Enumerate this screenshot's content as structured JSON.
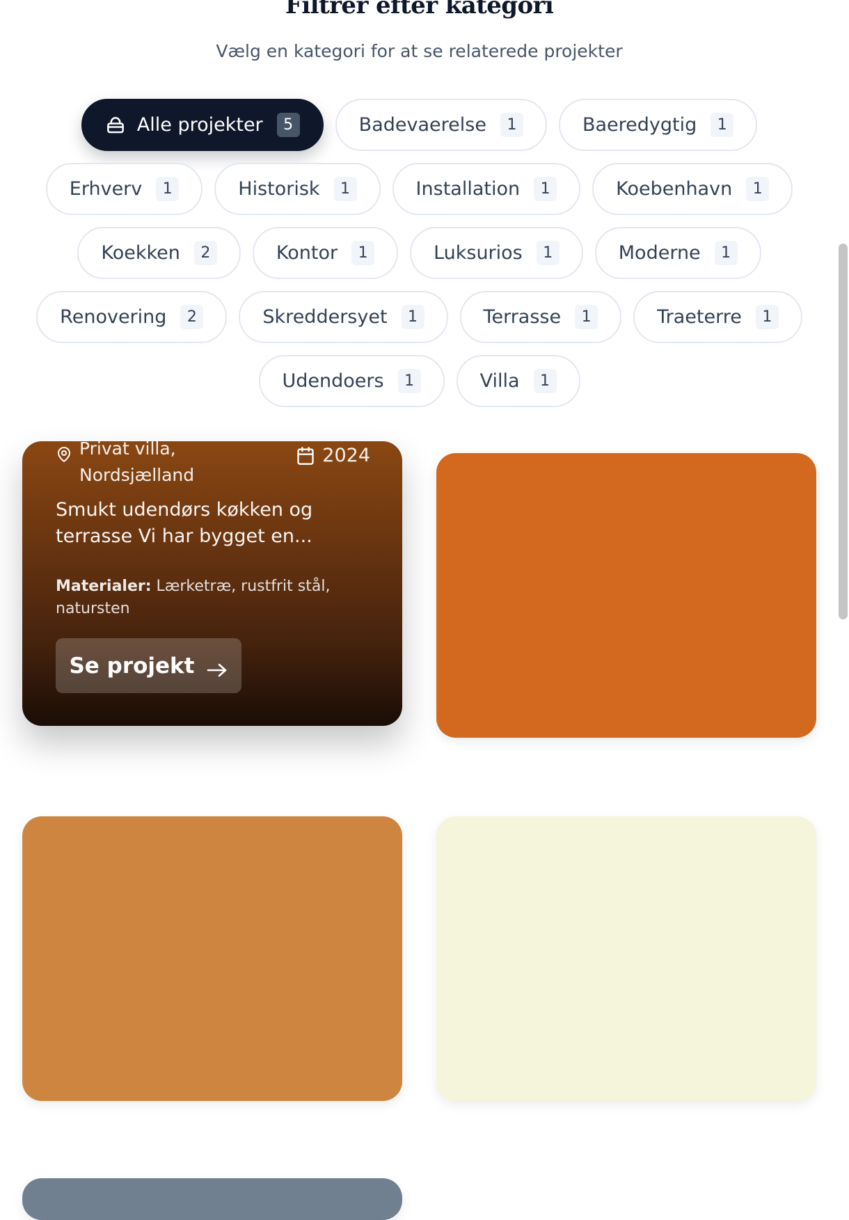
{
  "filter": {
    "title": "Filtrer efter kategori",
    "subtitle": "Vælg en kategori for at se relaterede projekter",
    "categories": [
      {
        "label": "Alle projekter",
        "count": "5",
        "active": true,
        "icon": "bag-icon"
      },
      {
        "label": "Badevaerelse",
        "count": "1"
      },
      {
        "label": "Baeredygtig",
        "count": "1"
      },
      {
        "label": "Erhverv",
        "count": "1"
      },
      {
        "label": "Historisk",
        "count": "1"
      },
      {
        "label": "Installation",
        "count": "1"
      },
      {
        "label": "Koebenhavn",
        "count": "1"
      },
      {
        "label": "Koekken",
        "count": "2"
      },
      {
        "label": "Kontor",
        "count": "1"
      },
      {
        "label": "Luksurios",
        "count": "1"
      },
      {
        "label": "Moderne",
        "count": "1"
      },
      {
        "label": "Renovering",
        "count": "2"
      },
      {
        "label": "Skreddersyet",
        "count": "1"
      },
      {
        "label": "Terrasse",
        "count": "1"
      },
      {
        "label": "Traeterre",
        "count": "1"
      },
      {
        "label": "Udendoers",
        "count": "1"
      },
      {
        "label": "Villa",
        "count": "1"
      }
    ]
  },
  "projects": [
    {
      "location": "Privat villa, Nordsjælland",
      "year": "2024",
      "description": "Smukt udendørs køkken og terrasse Vi har bygget en...",
      "materials_label": "Materialer:",
      "materials": "Lærketræ, rustfrit stål, natursten",
      "button_label": "Se projekt",
      "color": "#8b4513"
    },
    {
      "color": "#d2691e"
    },
    {
      "color": "#cd853f"
    },
    {
      "color": "#f5f5dc"
    },
    {
      "color": "#708090"
    }
  ],
  "icons": {
    "location": "map-pin-icon",
    "year": "calendar-icon",
    "button": "arrow-right-icon"
  },
  "colors": {
    "active_chip": "#0f172a",
    "chip_border": "#e2e8f0",
    "text": "#334155"
  }
}
